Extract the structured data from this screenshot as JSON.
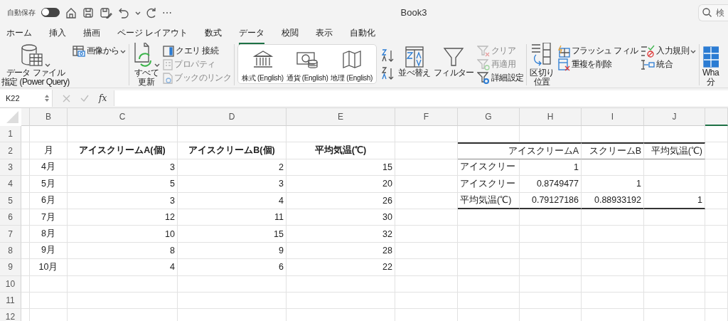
{
  "title_bar": {
    "autosave_label": "自動保存",
    "autosave_on": false,
    "more": "⋯",
    "title": "Book3",
    "search": {
      "placeholder": "検"
    }
  },
  "tabs": [
    {
      "label": "ホーム",
      "selected": false
    },
    {
      "label": "挿入",
      "selected": false
    },
    {
      "label": "描画",
      "selected": false
    },
    {
      "label": "ページ レイアウト",
      "selected": false
    },
    {
      "label": "数式",
      "selected": false
    },
    {
      "label": "データ",
      "selected": true
    },
    {
      "label": "校閲",
      "selected": false
    },
    {
      "label": "表示",
      "selected": false
    },
    {
      "label": "自動化",
      "selected": false
    }
  ],
  "ribbon": {
    "groups": [
      {
        "items": [
          {
            "kind": "big",
            "lines": [
              "データ ファイル",
              "指定 (Power Query)"
            ]
          },
          {
            "kind": "smallcol",
            "items": [
              {
                "label": "画像から",
                "disabled": false
              }
            ]
          }
        ]
      },
      {
        "items": [
          {
            "kind": "big",
            "lines": [
              "すべて",
              "更新"
            ]
          },
          {
            "kind": "smallcol",
            "items": [
              {
                "label": "クエリ 接続",
                "disabled": false
              },
              {
                "label": "プロパティ",
                "disabled": true
              },
              {
                "label": "ブックのリンク",
                "disabled": true
              }
            ]
          }
        ]
      },
      {
        "items": [
          {
            "kind": "type",
            "label": "株式 (English)"
          },
          {
            "kind": "type",
            "label": "通貨 (English)"
          },
          {
            "kind": "type",
            "label": "地理 (English)"
          }
        ]
      },
      {
        "items": [
          {
            "kind": "sortpair"
          },
          {
            "kind": "big",
            "lines": [
              "並べ替え"
            ]
          },
          {
            "kind": "big",
            "lines": [
              "フィルター"
            ]
          },
          {
            "kind": "smallcol",
            "items": [
              {
                "label": "クリア",
                "disabled": true
              },
              {
                "label": "再適用",
                "disabled": true
              },
              {
                "label": "詳細設定",
                "disabled": false
              }
            ]
          }
        ]
      },
      {
        "items": [
          {
            "kind": "big",
            "lines": [
              "区切り",
              "位置"
            ]
          },
          {
            "kind": "smallcol",
            "items": [
              {
                "label": "フラッシュ フィル",
                "disabled": false
              },
              {
                "label": "重複を削除",
                "disabled": false
              }
            ]
          },
          {
            "kind": "smallcol",
            "items": [
              {
                "label": "入力規則",
                "disabled": false
              },
              {
                "label": "統合",
                "disabled": false
              }
            ]
          }
        ]
      },
      {
        "items": [
          {
            "kind": "big",
            "lines": [
              "Wha",
              "分"
            ]
          }
        ]
      }
    ]
  },
  "formula_bar": {
    "name_box": "K22",
    "function_label": "fx"
  },
  "sheet": {
    "columns": [
      {
        "kind": "spacer",
        "selected": false
      },
      {
        "letter": "B",
        "kind": "label",
        "selected": false
      },
      {
        "letter": "C",
        "kind": "value",
        "selected": false
      },
      {
        "letter": "D",
        "kind": "value",
        "selected": false
      },
      {
        "letter": "E",
        "kind": "value",
        "selected": false
      },
      {
        "letter": "F",
        "kind": "value",
        "selected": false
      },
      {
        "letter": "G",
        "kind": "table-label",
        "selected": false
      },
      {
        "letter": "H",
        "kind": "table-value",
        "selected": false
      },
      {
        "letter": "I",
        "kind": "table-value",
        "selected": false
      },
      {
        "letter": "J",
        "kind": "table-value",
        "selected": false
      },
      {
        "kind": "value",
        "selected": true
      }
    ],
    "rows": [
      {
        "number": "1",
        "kind": "body",
        "cells": []
      },
      {
        "number": "2",
        "kind": "heading",
        "cells": [
          "",
          "月",
          "アイスクリームA(個)",
          "アイスクリームB(個)",
          "平均気温(℃)",
          "",
          "",
          "アイスクリームA",
          "スクリームB",
          "平均気温(℃)"
        ]
      },
      {
        "number": "3",
        "kind": "table-body",
        "cells": [
          "",
          "4月",
          "3",
          "2",
          "15",
          "",
          "アイスクリー",
          "1"
        ]
      },
      {
        "number": "4",
        "kind": "table-body",
        "cells": [
          "",
          "5月",
          "5",
          "3",
          "20",
          "",
          "アイスクリー",
          "0.8749477",
          "1"
        ]
      },
      {
        "number": "5",
        "kind": "table-end",
        "cells": [
          "",
          "6月",
          "3",
          "4",
          "26",
          "",
          "平均気温(℃)",
          "0.79127186",
          "0.88933192",
          "1"
        ]
      },
      {
        "number": "6",
        "kind": "body",
        "cells": [
          "",
          "7月",
          "12",
          "11",
          "30"
        ]
      },
      {
        "number": "7",
        "kind": "body",
        "cells": [
          "",
          "8月",
          "10",
          "15",
          "32"
        ]
      },
      {
        "number": "8",
        "kind": "body",
        "cells": [
          "",
          "9月",
          "8",
          "9",
          "28"
        ]
      },
      {
        "number": "9",
        "kind": "body",
        "cells": [
          "",
          "10月",
          "4",
          "6",
          "22"
        ]
      },
      {
        "number": "10",
        "kind": "body",
        "cells": []
      },
      {
        "number": "11",
        "kind": "body",
        "cells": []
      },
      {
        "number": "12",
        "kind": "body",
        "cells": []
      }
    ]
  }
}
